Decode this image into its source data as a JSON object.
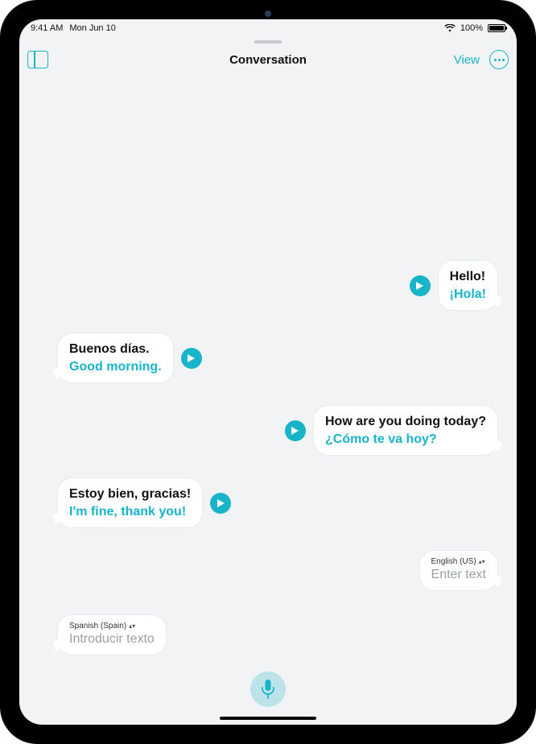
{
  "status": {
    "time": "9:41 AM",
    "date": "Mon Jun 10",
    "battery_pct": "100%"
  },
  "nav": {
    "title": "Conversation",
    "view_label": "View"
  },
  "messages": [
    {
      "side": "right",
      "original": "Hello!",
      "translation": "¡Hola!"
    },
    {
      "side": "left",
      "original": "Buenos días.",
      "translation": "Good morning."
    },
    {
      "side": "right",
      "original": "How are you doing today?",
      "translation": "¿Cómo te va hoy?"
    },
    {
      "side": "left",
      "original": "Estoy bien, gracias!",
      "translation": "I'm fine, thank you!"
    }
  ],
  "inputs": {
    "right": {
      "language": "English (US)",
      "placeholder": "Enter text"
    },
    "left": {
      "language": "Spanish (Spain)",
      "placeholder": "Introducir texto"
    }
  },
  "colors": {
    "accent": "#18b4c9",
    "bg": "#f2f3f5"
  }
}
